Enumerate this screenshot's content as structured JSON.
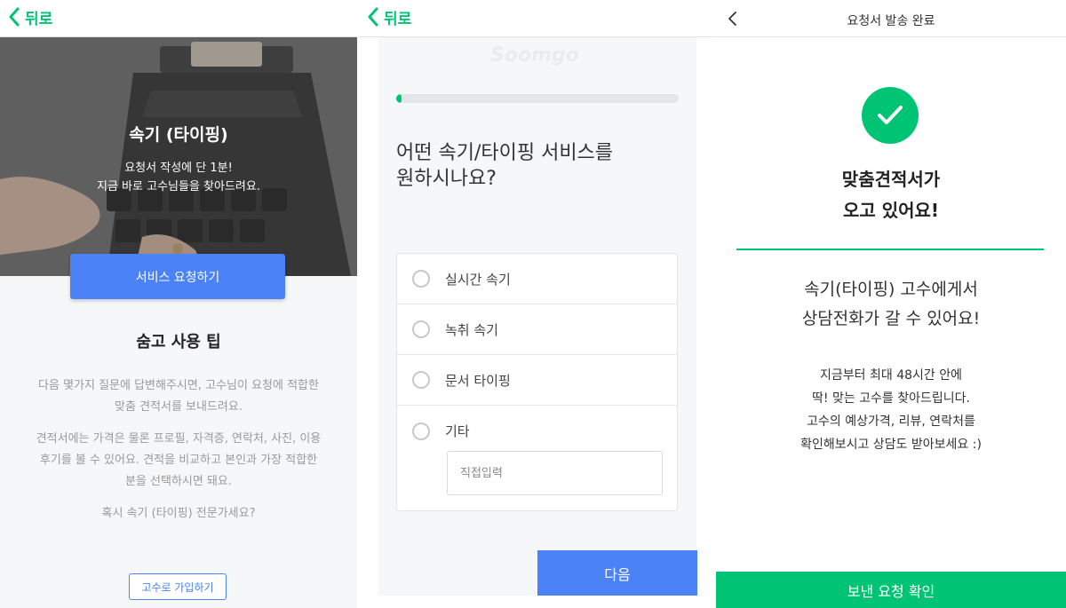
{
  "panel1": {
    "back_label": "뒤로",
    "hero_title": "속기 (타이핑)",
    "hero_sub_line1": "요청서 작성에 단 1분!",
    "hero_sub_line2": "지금 바로 고수님들을 찾아드려요.",
    "request_button": "서비스 요청하기",
    "tips_title": "숨고 사용 팁",
    "tip1_line1": "다음 몇가지 질문에 답변해주시면, 고수님이 요청에 적합한",
    "tip1_line2": "맞춤 견적서를 보내드려요.",
    "tip2_line1": "견적서에는 가격은 물론 프로필, 자격증, 연락처, 사진, 이용",
    "tip2_line2": "후기를 볼 수 있어요. 견적을 비교하고 본인과 가장 적합한",
    "tip2_line3": "분을 선택하시면 돼요.",
    "expert_question": "혹시 속기 (타이핑) 전문가세요?",
    "join_button": "고수로 가입하기"
  },
  "panel2": {
    "back_label": "뒤로",
    "watermark": "Soomgo",
    "progress": 0.02,
    "question_line1": "어떤 속기/타이핑 서비스를",
    "question_line2": "원하시나요?",
    "options": [
      "실시간 속기",
      "녹취 속기",
      "문서 타이핑",
      "기타"
    ],
    "direct_input_placeholder": "직접입력",
    "next_button": "다음"
  },
  "panel3": {
    "title": "요청서 발송 완료",
    "big_line1": "맞춤견적서가",
    "big_line2": "오고 있어요!",
    "mid_line1": "속기(타이핑) 고수에게서",
    "mid_line2": "상담전화가 갈 수 있어요!",
    "small_line1": "지금부터 최대 48시간 안에",
    "small_line2": "딱! 맞는 고수를 찾아드립니다.",
    "small_line3": "고수의 예상가격, 리뷰, 연락처를",
    "small_line4": "확인해보시고 상담도 받아보세요 :)",
    "confirm_button": "보낸 요청 확인"
  },
  "colors": {
    "brand_green": "#00c473",
    "brand_blue": "#4c82f7"
  },
  "icons": [
    "chevron-left-icon",
    "check-icon"
  ]
}
